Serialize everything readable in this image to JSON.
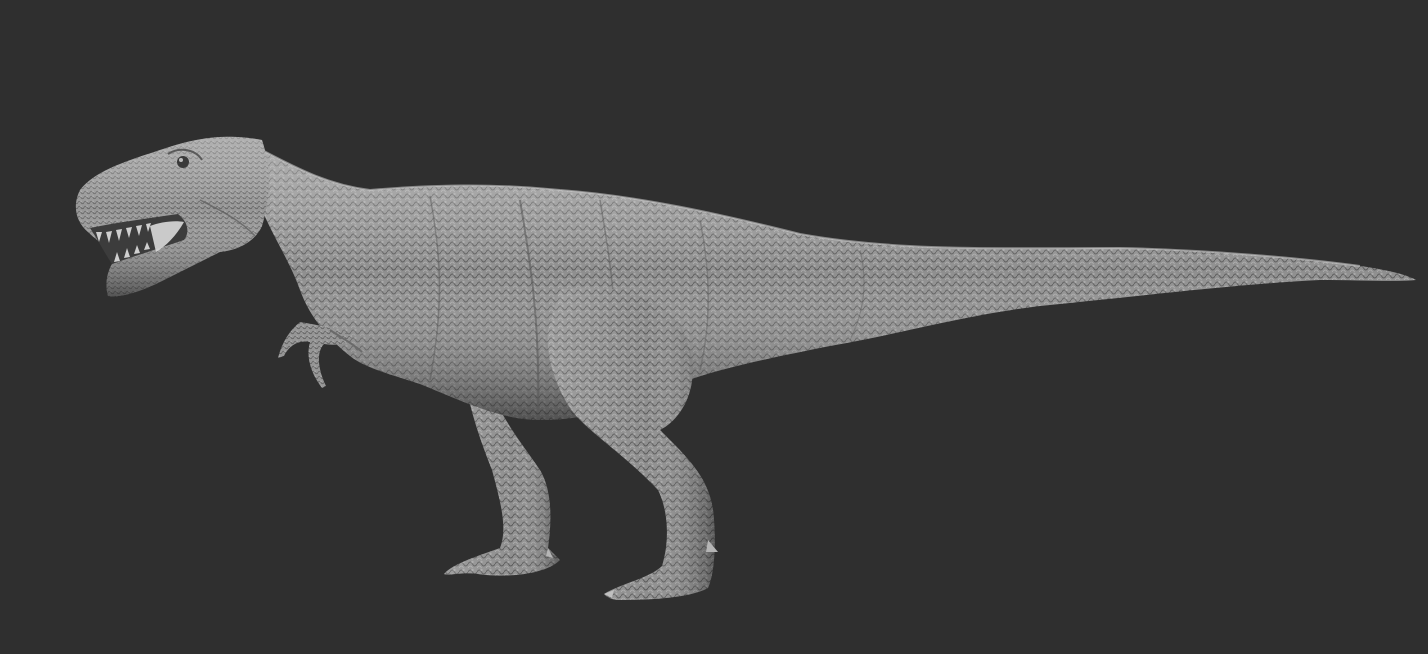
{
  "scene": {
    "background_color": "#2f2f2f",
    "model": {
      "subject": "t-rex-sculpt",
      "material": "matcap-grey",
      "base_color": "#9a9a9a",
      "highlight_color": "#cfcfcf",
      "shadow_color": "#4a4a4a",
      "facing": "left"
    }
  }
}
